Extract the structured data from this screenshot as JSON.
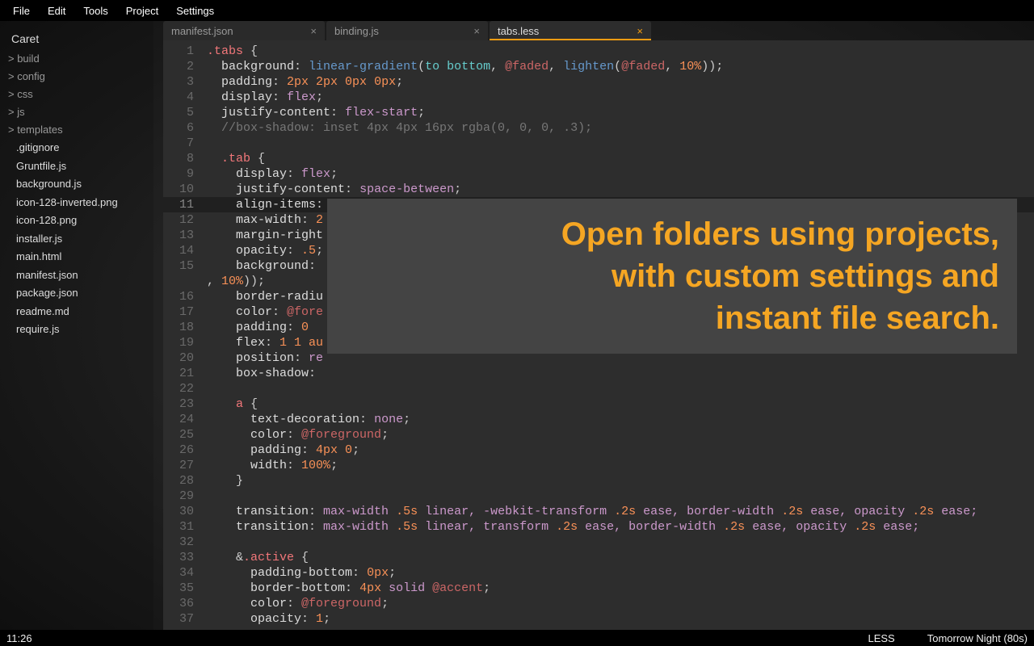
{
  "menu": [
    "File",
    "Edit",
    "Tools",
    "Project",
    "Settings"
  ],
  "sidebar": {
    "title": "Caret",
    "folders": [
      "build",
      "config",
      "css",
      "js",
      "templates"
    ],
    "files": [
      ".gitignore",
      "Gruntfile.js",
      "background.js",
      "icon-128-inverted.png",
      "icon-128.png",
      "installer.js",
      "main.html",
      "manifest.json",
      "package.json",
      "readme.md",
      "require.js"
    ]
  },
  "tabs": [
    {
      "label": "manifest.json",
      "active": false,
      "dirty": false
    },
    {
      "label": "binding.js",
      "active": false,
      "dirty": false
    },
    {
      "label": "tabs.less",
      "active": true,
      "dirty": false
    }
  ],
  "overlay": {
    "l1": "Open folders using projects,",
    "l2": "with custom settings and",
    "l3": "instant file search."
  },
  "status": {
    "pos": "11:26",
    "lang": "LESS",
    "theme": "Tomorrow Night (80s)"
  },
  "editor": {
    "current_line": 11,
    "lines": [
      {
        "n": 1,
        "seg": [
          [
            ".tabs",
            "sel"
          ],
          [
            " {",
            "punc"
          ]
        ]
      },
      {
        "n": 2,
        "seg": [
          [
            "  ",
            "punc"
          ],
          [
            "background",
            "prop"
          ],
          [
            ": ",
            "punc"
          ],
          [
            "linear-gradient",
            "fn"
          ],
          [
            "(",
            "punc"
          ],
          [
            "to bottom",
            "arg"
          ],
          [
            ", ",
            "punc"
          ],
          [
            "@faded",
            "var"
          ],
          [
            ", ",
            "punc"
          ],
          [
            "lighten",
            "fn"
          ],
          [
            "(",
            "punc"
          ],
          [
            "@faded",
            "var"
          ],
          [
            ", ",
            "punc"
          ],
          [
            "10%",
            "num"
          ],
          [
            "));",
            "punc"
          ]
        ]
      },
      {
        "n": 3,
        "seg": [
          [
            "  ",
            "punc"
          ],
          [
            "padding",
            "prop"
          ],
          [
            ": ",
            "punc"
          ],
          [
            "2px 2px 0px 0px",
            "num"
          ],
          [
            ";",
            "punc"
          ]
        ]
      },
      {
        "n": 4,
        "seg": [
          [
            "  ",
            "punc"
          ],
          [
            "display",
            "prop"
          ],
          [
            ": ",
            "punc"
          ],
          [
            "flex",
            "kw"
          ],
          [
            ";",
            "punc"
          ]
        ]
      },
      {
        "n": 5,
        "seg": [
          [
            "  ",
            "punc"
          ],
          [
            "justify-content",
            "prop"
          ],
          [
            ": ",
            "punc"
          ],
          [
            "flex-start",
            "kw"
          ],
          [
            ";",
            "punc"
          ]
        ]
      },
      {
        "n": 6,
        "seg": [
          [
            "  //box-shadow: inset 4px 4px 16px rgba(0, 0, 0, .3);",
            "comm"
          ]
        ]
      },
      {
        "n": 7,
        "seg": [
          [
            "",
            "punc"
          ]
        ]
      },
      {
        "n": 8,
        "seg": [
          [
            "  ",
            "punc"
          ],
          [
            ".tab",
            "sel"
          ],
          [
            " {",
            "punc"
          ]
        ]
      },
      {
        "n": 9,
        "seg": [
          [
            "    ",
            "punc"
          ],
          [
            "display",
            "prop"
          ],
          [
            ": ",
            "punc"
          ],
          [
            "flex",
            "kw"
          ],
          [
            ";",
            "punc"
          ]
        ]
      },
      {
        "n": 10,
        "seg": [
          [
            "    ",
            "punc"
          ],
          [
            "justify-content",
            "prop"
          ],
          [
            ": ",
            "punc"
          ],
          [
            "space-between",
            "kw"
          ],
          [
            ";",
            "punc"
          ]
        ]
      },
      {
        "n": 11,
        "seg": [
          [
            "    ",
            "punc"
          ],
          [
            "align-items",
            "prop"
          ],
          [
            ":",
            "punc"
          ]
        ]
      },
      {
        "n": 12,
        "seg": [
          [
            "    ",
            "punc"
          ],
          [
            "max-width",
            "prop"
          ],
          [
            ": ",
            "punc"
          ],
          [
            "2",
            "num"
          ]
        ]
      },
      {
        "n": 13,
        "seg": [
          [
            "    ",
            "punc"
          ],
          [
            "margin-right",
            "prop"
          ]
        ]
      },
      {
        "n": 14,
        "seg": [
          [
            "    ",
            "punc"
          ],
          [
            "opacity",
            "prop"
          ],
          [
            ": ",
            "punc"
          ],
          [
            ".5",
            "num"
          ],
          [
            ";",
            "punc"
          ]
        ]
      },
      {
        "n": 15,
        "seg": [
          [
            "    ",
            "punc"
          ],
          [
            "background",
            "prop"
          ],
          [
            ": ",
            "punc"
          ]
        ]
      },
      {
        "n": 0,
        "wrap": true,
        "seg": [
          [
            ", ",
            "punc"
          ],
          [
            "10%",
            "num"
          ],
          [
            "));",
            "punc"
          ]
        ]
      },
      {
        "n": 16,
        "seg": [
          [
            "    ",
            "punc"
          ],
          [
            "border-radiu",
            "prop"
          ]
        ]
      },
      {
        "n": 17,
        "seg": [
          [
            "    ",
            "punc"
          ],
          [
            "color",
            "prop"
          ],
          [
            ": ",
            "punc"
          ],
          [
            "@fore",
            "var"
          ]
        ]
      },
      {
        "n": 18,
        "seg": [
          [
            "    ",
            "punc"
          ],
          [
            "padding",
            "prop"
          ],
          [
            ": ",
            "punc"
          ],
          [
            "0",
            "num"
          ]
        ]
      },
      {
        "n": 19,
        "seg": [
          [
            "    ",
            "punc"
          ],
          [
            "flex",
            "prop"
          ],
          [
            ": ",
            "punc"
          ],
          [
            "1 1 au",
            "num"
          ]
        ]
      },
      {
        "n": 20,
        "seg": [
          [
            "    ",
            "punc"
          ],
          [
            "position",
            "prop"
          ],
          [
            ": ",
            "punc"
          ],
          [
            "re",
            "kw"
          ]
        ]
      },
      {
        "n": 21,
        "seg": [
          [
            "    ",
            "punc"
          ],
          [
            "box-shadow",
            "prop"
          ],
          [
            ": ",
            "punc"
          ]
        ]
      },
      {
        "n": 22,
        "seg": [
          [
            "",
            "punc"
          ]
        ]
      },
      {
        "n": 23,
        "seg": [
          [
            "    ",
            "punc"
          ],
          [
            "a",
            "sel"
          ],
          [
            " {",
            "punc"
          ]
        ]
      },
      {
        "n": 24,
        "seg": [
          [
            "      ",
            "punc"
          ],
          [
            "text-decoration",
            "prop"
          ],
          [
            ": ",
            "punc"
          ],
          [
            "none",
            "kw"
          ],
          [
            ";",
            "punc"
          ]
        ]
      },
      {
        "n": 25,
        "seg": [
          [
            "      ",
            "punc"
          ],
          [
            "color",
            "prop"
          ],
          [
            ": ",
            "punc"
          ],
          [
            "@foreground",
            "var"
          ],
          [
            ";",
            "punc"
          ]
        ]
      },
      {
        "n": 26,
        "seg": [
          [
            "      ",
            "punc"
          ],
          [
            "padding",
            "prop"
          ],
          [
            ": ",
            "punc"
          ],
          [
            "4px 0",
            "num"
          ],
          [
            ";",
            "punc"
          ]
        ]
      },
      {
        "n": 27,
        "seg": [
          [
            "      ",
            "punc"
          ],
          [
            "width",
            "prop"
          ],
          [
            ": ",
            "punc"
          ],
          [
            "100%",
            "num"
          ],
          [
            ";",
            "punc"
          ]
        ]
      },
      {
        "n": 28,
        "seg": [
          [
            "    }",
            "punc"
          ]
        ]
      },
      {
        "n": 29,
        "seg": [
          [
            "",
            "punc"
          ]
        ]
      },
      {
        "n": 30,
        "seg": [
          [
            "    ",
            "punc"
          ],
          [
            "transition",
            "prop"
          ],
          [
            ": ",
            "punc"
          ],
          [
            "max-width ",
            "kw"
          ],
          [
            ".5s",
            "num"
          ],
          [
            " linear, ",
            "kw"
          ],
          [
            "-webkit-transform ",
            "kw"
          ],
          [
            ".2s",
            "num"
          ],
          [
            " ease, ",
            "kw"
          ],
          [
            "border-width ",
            "kw"
          ],
          [
            ".2s",
            "num"
          ],
          [
            " ease, ",
            "kw"
          ],
          [
            "opacity ",
            "kw"
          ],
          [
            ".2s",
            "num"
          ],
          [
            " ease;",
            "kw"
          ]
        ]
      },
      {
        "n": 31,
        "seg": [
          [
            "    ",
            "punc"
          ],
          [
            "transition",
            "prop"
          ],
          [
            ": ",
            "punc"
          ],
          [
            "max-width ",
            "kw"
          ],
          [
            ".5s",
            "num"
          ],
          [
            " linear, ",
            "kw"
          ],
          [
            "transform ",
            "kw"
          ],
          [
            ".2s",
            "num"
          ],
          [
            " ease, ",
            "kw"
          ],
          [
            "border-width ",
            "kw"
          ],
          [
            ".2s",
            "num"
          ],
          [
            " ease, ",
            "kw"
          ],
          [
            "opacity ",
            "kw"
          ],
          [
            ".2s",
            "num"
          ],
          [
            " ease;",
            "kw"
          ]
        ]
      },
      {
        "n": 32,
        "seg": [
          [
            "",
            "punc"
          ]
        ]
      },
      {
        "n": 33,
        "seg": [
          [
            "    &",
            "punc"
          ],
          [
            ".active",
            "sel"
          ],
          [
            " {",
            "punc"
          ]
        ]
      },
      {
        "n": 34,
        "seg": [
          [
            "      ",
            "punc"
          ],
          [
            "padding-bottom",
            "prop"
          ],
          [
            ": ",
            "punc"
          ],
          [
            "0px",
            "num"
          ],
          [
            ";",
            "punc"
          ]
        ]
      },
      {
        "n": 35,
        "seg": [
          [
            "      ",
            "punc"
          ],
          [
            "border-bottom",
            "prop"
          ],
          [
            ": ",
            "punc"
          ],
          [
            "4px",
            "num"
          ],
          [
            " solid ",
            "kw"
          ],
          [
            "@accent",
            "var"
          ],
          [
            ";",
            "punc"
          ]
        ]
      },
      {
        "n": 36,
        "seg": [
          [
            "      ",
            "punc"
          ],
          [
            "color",
            "prop"
          ],
          [
            ": ",
            "punc"
          ],
          [
            "@foreground",
            "var"
          ],
          [
            ";",
            "punc"
          ]
        ]
      },
      {
        "n": 37,
        "seg": [
          [
            "      ",
            "punc"
          ],
          [
            "opacity",
            "prop"
          ],
          [
            ": ",
            "punc"
          ],
          [
            "1",
            "num"
          ],
          [
            ";",
            "punc"
          ]
        ]
      }
    ]
  }
}
